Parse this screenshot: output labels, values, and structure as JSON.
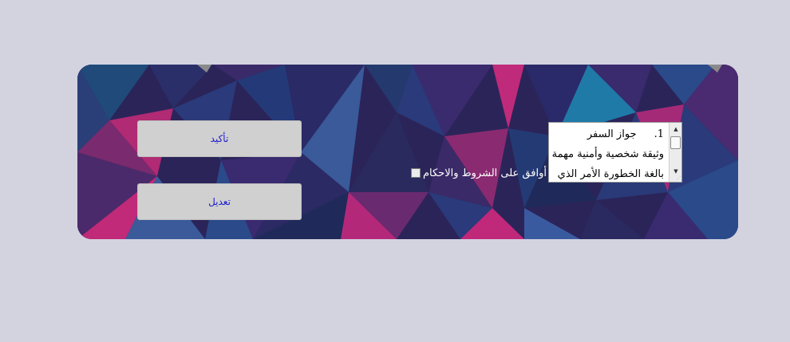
{
  "buttons": {
    "confirm_label": "تأكيد",
    "edit_label": "تعديل"
  },
  "terms": {
    "item_number": "1.",
    "item_title": "جواز السفر",
    "line2": "وثيقة شخصية وأمنية مهمة",
    "line3": "بالغة الخطورة الأمر الذي"
  },
  "agreement": {
    "label": "أوافق على الشروط والاحكام",
    "checked": false
  },
  "colors": {
    "page_background": "#d3d3e0",
    "button_background": "#d0d0d0",
    "button_text": "#1a1ad0",
    "panel_accent_pink": "#c0287a",
    "panel_accent_blue": "#2a5a9a",
    "panel_dark": "#2a2358"
  },
  "icons": {
    "scroll_up": "scroll-up-arrow-icon",
    "scroll_down": "scroll-down-arrow-icon",
    "resize_grip": "resize-grip-icon"
  }
}
